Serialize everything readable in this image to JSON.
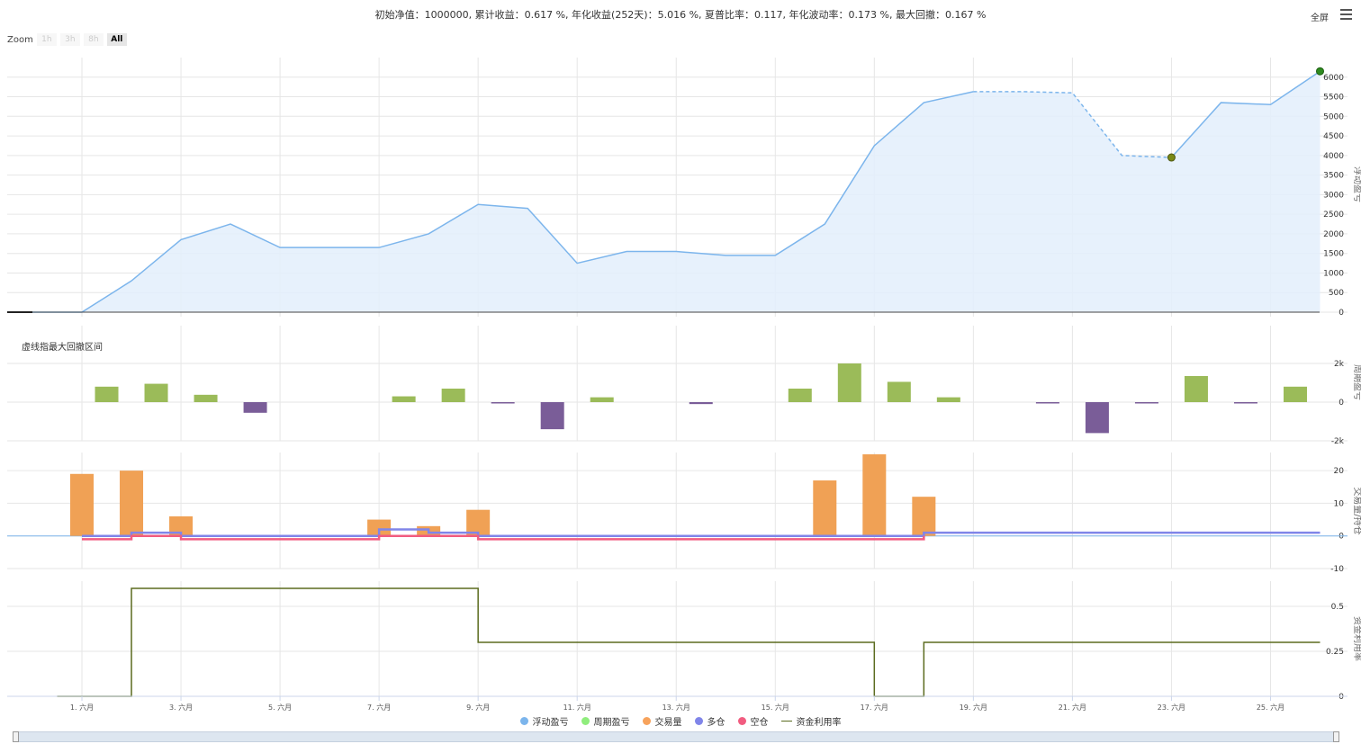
{
  "stats_text": "初始净值：1000000, 累计收益：0.617 %, 年化收益(252天)：5.016 %, 夏普比率：0.117, 年化波动率：0.173 %, 最大回撤：0.167 %",
  "fullscreen_label": "全屏",
  "zoom": {
    "label": "Zoom",
    "buttons": [
      "1h",
      "3h",
      "8h",
      "All"
    ],
    "active": "All"
  },
  "note": "虚线指最大回撤区间",
  "colors": {
    "floating": "#7cb5ec",
    "floating_fill": "#e3eefb",
    "period_pos": "#9bbb59",
    "period_neg": "#7a5d98",
    "volume": "#f0a155",
    "long": "#8085e9",
    "short": "#f15c80",
    "util": "#5b6b1f",
    "grid": "#e6e6e6",
    "marker_max": "#2e8b1f",
    "marker_min": "#7a8a18"
  },
  "chart_data": [
    {
      "type": "area",
      "name": "浮动盈亏",
      "ylabel": "浮动盈亏",
      "ylim": [
        0,
        6500
      ],
      "yticks": [
        0,
        500,
        1000,
        1500,
        2000,
        2500,
        3000,
        3500,
        4000,
        4500,
        5000,
        5500,
        6000
      ],
      "x": [
        "5/31",
        "5/31.5",
        "6/1",
        "6/2",
        "6/3",
        "6/4",
        "6/5",
        "6/6",
        "6/7",
        "6/8",
        "6/9",
        "6/10",
        "6/11",
        "6/12",
        "6/13",
        "6/14",
        "6/15",
        "6/16",
        "6/17",
        "6/18",
        "6/19",
        "6/20",
        "6/21",
        "6/22",
        "6/23",
        "6/24",
        "6/25",
        "6/26"
      ],
      "values": [
        0,
        0,
        0,
        800,
        1850,
        2250,
        1650,
        1650,
        1650,
        2000,
        2750,
        2650,
        1250,
        1550,
        1550,
        1450,
        1450,
        2250,
        4250,
        5350,
        5630,
        5630,
        5600,
        4000,
        3950,
        5350,
        5300,
        6150
      ],
      "drawdown": {
        "from": "6/19",
        "to": "6/23"
      },
      "max_marker": {
        "x": "6/26",
        "y": 6150
      },
      "min_marker": {
        "x": "6/23",
        "y": 3950
      }
    },
    {
      "type": "bar",
      "name": "周期盈亏",
      "ylabel": "周期盈亏",
      "ylim": [
        -2000,
        2000
      ],
      "yticks": [
        "-2k",
        "0",
        "2k"
      ],
      "ytick_values": [
        -2000,
        0,
        2000
      ],
      "x": [
        "6/2",
        "6/3",
        "6/4",
        "6/5",
        "6/6",
        "6/7",
        "6/8",
        "6/9",
        "6/10",
        "6/11",
        "6/12",
        "6/13",
        "6/14",
        "6/15",
        "6/16",
        "6/17",
        "6/18",
        "6/19",
        "6/20",
        "6/21",
        "6/22",
        "6/23",
        "6/24",
        "6/25",
        "6/26"
      ],
      "values": [
        800,
        950,
        380,
        -550,
        0,
        0,
        300,
        700,
        -60,
        -1400,
        250,
        0,
        -100,
        0,
        700,
        2000,
        1050,
        250,
        0,
        -30,
        -1600,
        -50,
        1350,
        -50,
        800
      ]
    },
    {
      "type": "bar",
      "name": "交易量",
      "ylabel": "交易量/持仓",
      "ylim": [
        -10,
        25
      ],
      "yticks": [
        -10,
        0,
        10,
        20
      ],
      "x": [
        "6/1",
        "6/2",
        "6/3",
        "6/7",
        "6/8",
        "6/9",
        "6/16",
        "6/17",
        "6/18"
      ],
      "values": [
        19,
        20,
        6,
        5,
        3,
        8,
        17,
        25,
        12
      ],
      "series": [
        {
          "name": "多仓",
          "x": [
            "6/1",
            "6/2",
            "6/3",
            "6/7",
            "6/8",
            "6/9",
            "6/17",
            "6/18",
            "6/26"
          ],
          "values": [
            0,
            1,
            0,
            2,
            1,
            0,
            0,
            1,
            1
          ]
        },
        {
          "name": "空仓",
          "x": [
            "6/1",
            "6/2",
            "6/3",
            "6/7",
            "6/9",
            "6/16",
            "6/17",
            "6/18"
          ],
          "values": [
            -1,
            0,
            -1,
            0,
            -1,
            -1,
            -1,
            0
          ]
        }
      ]
    },
    {
      "type": "line",
      "name": "资金利用率",
      "ylabel": "资金利用率",
      "ylim": [
        0,
        0.62
      ],
      "yticks": [
        0,
        0.25,
        0.5
      ],
      "x": [
        "5/31.5",
        "6/2",
        "6/2",
        "6/9",
        "6/9",
        "6/17",
        "6/17",
        "6/18",
        "6/18",
        "6/26"
      ],
      "values": [
        0,
        0,
        0.6,
        0.6,
        0.3,
        0.3,
        0,
        0,
        0.3,
        0.3
      ]
    }
  ],
  "x_axis": {
    "ticks": [
      "1. 六月",
      "3. 六月",
      "5. 六月",
      "7. 六月",
      "9. 六月",
      "11. 六月",
      "13. 六月",
      "15. 六月",
      "17. 六月",
      "19. 六月",
      "21. 六月",
      "23. 六月",
      "25. 六月"
    ],
    "tick_days": [
      1,
      3,
      5,
      7,
      9,
      11,
      13,
      15,
      17,
      19,
      21,
      23,
      25
    ]
  },
  "navigator_ticks": [
    "1. 六月",
    "3. 六月",
    "5. 六月",
    "7. 六月",
    "9. 六月",
    "11. 六月",
    "13. 六月",
    "15. 六月",
    "17. 六月",
    "19. 六月",
    "21. 六月",
    "23. 六月",
    "25. 六月"
  ],
  "legend": [
    {
      "name": "浮动盈亏",
      "color": "#7cb5ec",
      "shape": "dot"
    },
    {
      "name": "周期盈亏",
      "color": "#90ed7d",
      "shape": "dot"
    },
    {
      "name": "交易量",
      "color": "#f7a35c",
      "shape": "dot"
    },
    {
      "name": "多仓",
      "color": "#8085e9",
      "shape": "dot"
    },
    {
      "name": "空仓",
      "color": "#f15c80",
      "shape": "dot"
    },
    {
      "name": "资金利用率",
      "color": "#5b6b1f",
      "shape": "line"
    }
  ]
}
